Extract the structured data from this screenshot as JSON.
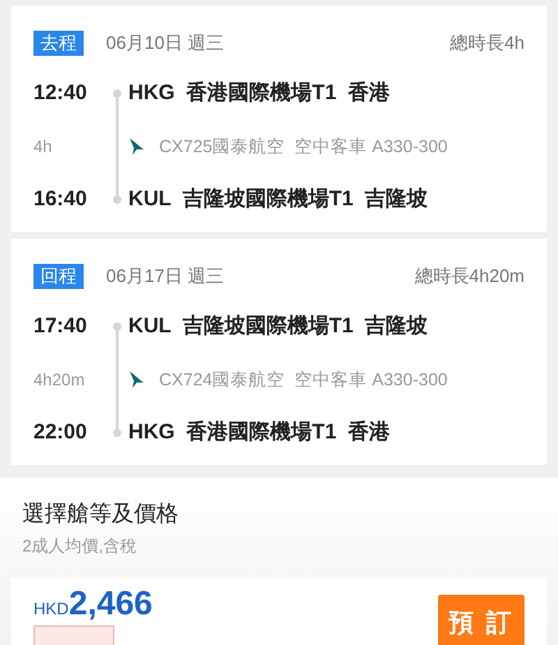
{
  "segments": [
    {
      "badge": "去程",
      "date": "06月10日 週三",
      "total": "總時長4h",
      "depart_time": "12:40",
      "depart_place": "HKG  香港國際機場T1  香港",
      "duration": "4h",
      "flight": "CX725國泰航空  空中客車 A330-300",
      "arrive_time": "16:40",
      "arrive_place": "KUL  吉隆坡國際機場T1  吉隆坡"
    },
    {
      "badge": "回程",
      "date": "06月17日 週三",
      "total": "總時長4h20m",
      "depart_time": "17:40",
      "depart_place": "KUL  吉隆坡國際機場T1  吉隆坡",
      "duration": "4h20m",
      "flight": "CX724國泰航空  空中客車 A330-300",
      "arrive_time": "22:00",
      "arrive_place": "HKG  香港國際機場T1  香港"
    }
  ],
  "fare_section": {
    "title": "選擇艙等及價格",
    "subtitle": "2成人均價,含稅"
  },
  "fare": {
    "currency": "HKD",
    "price": "2,466",
    "book_button": "預 訂"
  }
}
